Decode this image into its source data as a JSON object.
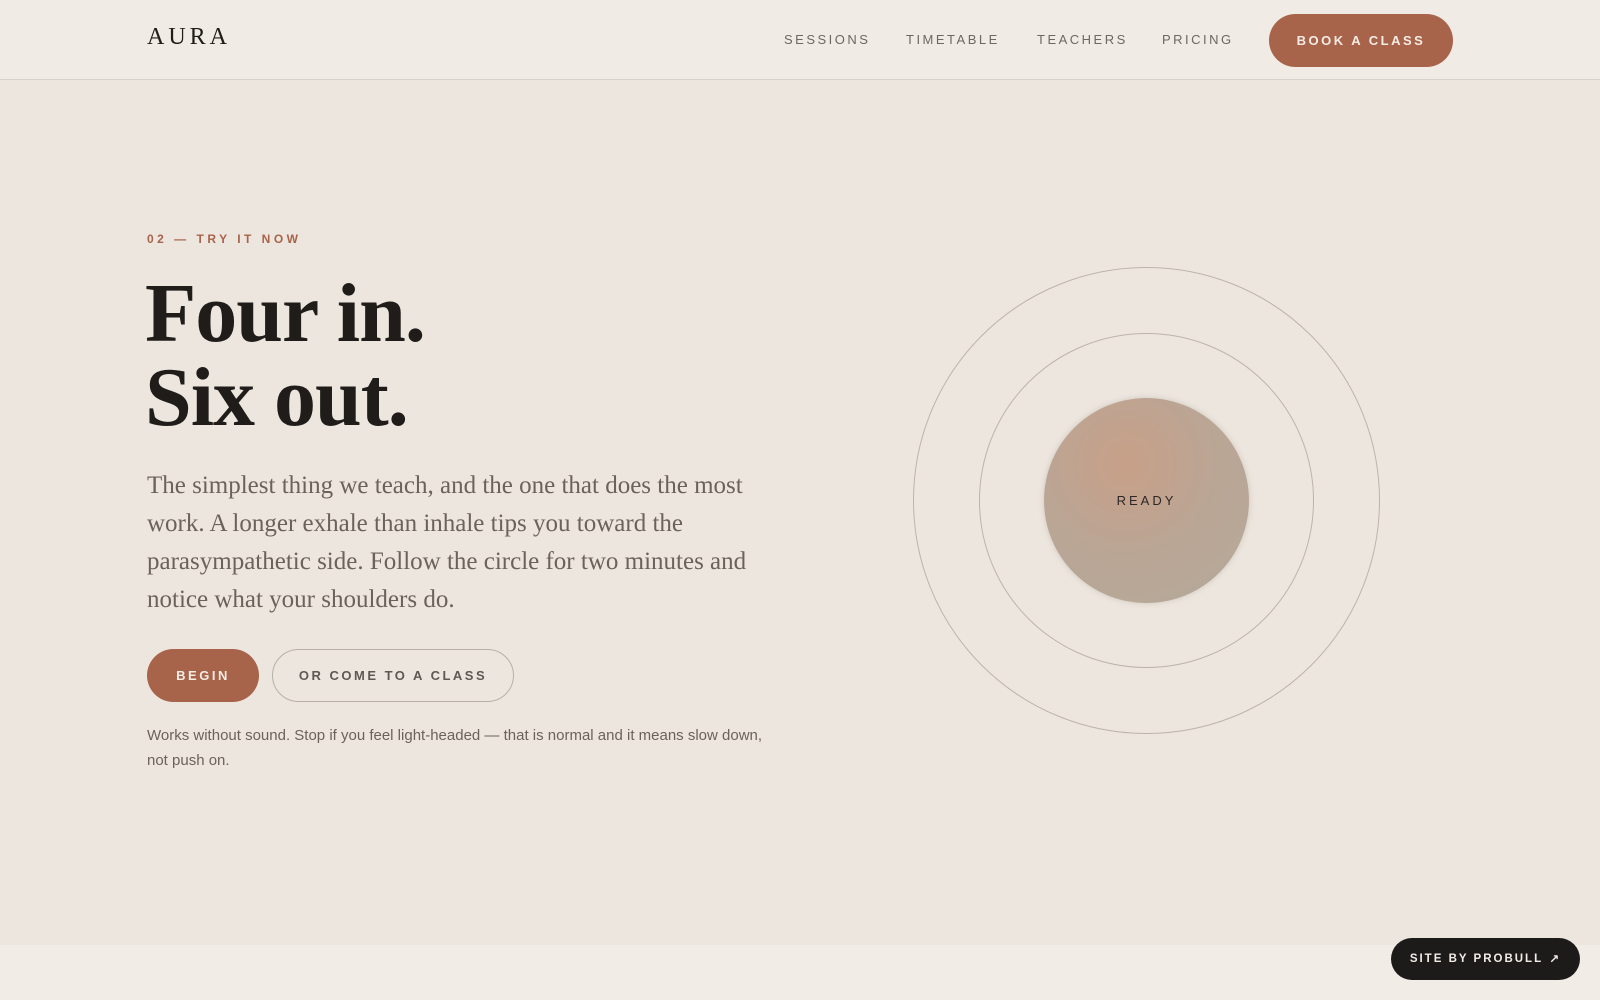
{
  "header": {
    "logo": "AURA",
    "nav": [
      "SESSIONS",
      "TIMETABLE",
      "TEACHERS",
      "PRICING"
    ],
    "cta": "BOOK A CLASS"
  },
  "hero": {
    "eyebrow": "02 — TRY IT NOW",
    "headline_line1": "Four in.",
    "headline_line2": "Six out.",
    "body": "The simplest thing we teach, and the one that does the most work. A longer exhale than inhale tips you toward the parasympathetic side. Follow the circle for two minutes and notice what your shoulders do.",
    "primary_button": "BEGIN",
    "secondary_button": "OR COME TO A CLASS",
    "note": "Works without sound. Stop if you feel light-headed — that is normal and it means slow down, not push on."
  },
  "breath": {
    "state_label": "READY"
  },
  "footer": {
    "badge": "SITE BY PROBULL",
    "badge_icon": "arrow-up-right-icon"
  },
  "colors": {
    "accent": "#a8634b",
    "background": "#ede6de",
    "header": "#f0ebe4",
    "text": "#1f1c19",
    "muted": "#6b625b",
    "badge": "#1d1b19"
  }
}
